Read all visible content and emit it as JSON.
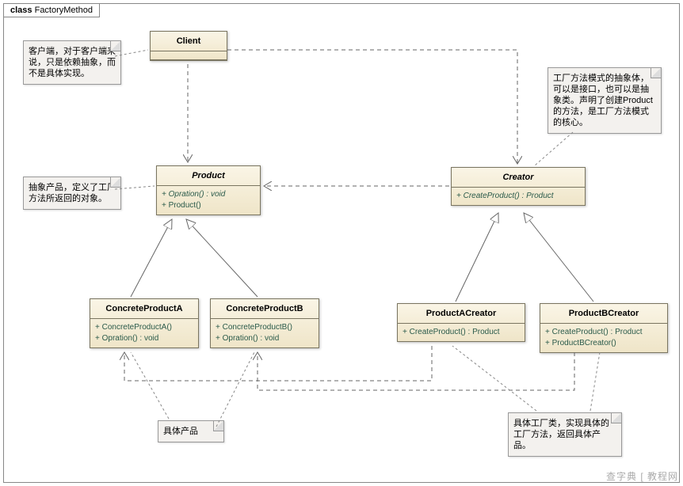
{
  "frame": {
    "label_prefix": "class",
    "name": "FactoryMethod"
  },
  "client": {
    "name": "Client"
  },
  "product": {
    "name": "Product",
    "ops": [
      "+  Opration() : void",
      "+  Product()"
    ]
  },
  "creator": {
    "name": "Creator",
    "ops": [
      "+  CreateProduct() : Product"
    ]
  },
  "cpa": {
    "name": "ConcreteProductA",
    "ops": [
      "+  ConcreteProductA()",
      "+  Opration() : void"
    ]
  },
  "cpb": {
    "name": "ConcreteProductB",
    "ops": [
      "+  ConcreteProductB()",
      "+  Opration() : void"
    ]
  },
  "pac": {
    "name": "ProductACreator",
    "ops": [
      "+  CreateProduct() : Product"
    ]
  },
  "pbc": {
    "name": "ProductBCreator",
    "ops": [
      "+  CreateProduct() : Product",
      "+  ProductBCreator()"
    ]
  },
  "notes": {
    "client": "客户端，对于客户端来说，只是依赖抽象，而不是具体实现。",
    "product": "抽象产品，定义了工厂方法所返回的对象。",
    "creator": "工厂方法模式的抽象体，可以是接口，也可以是抽象类。声明了创建Product的方法，是工厂方法模式的核心。",
    "concrete_product": "具体产品",
    "concrete_creator": "具体工厂类，实现具体的工厂方法，返回具体产品。"
  },
  "watermark": "查字典 [ 教程网"
}
